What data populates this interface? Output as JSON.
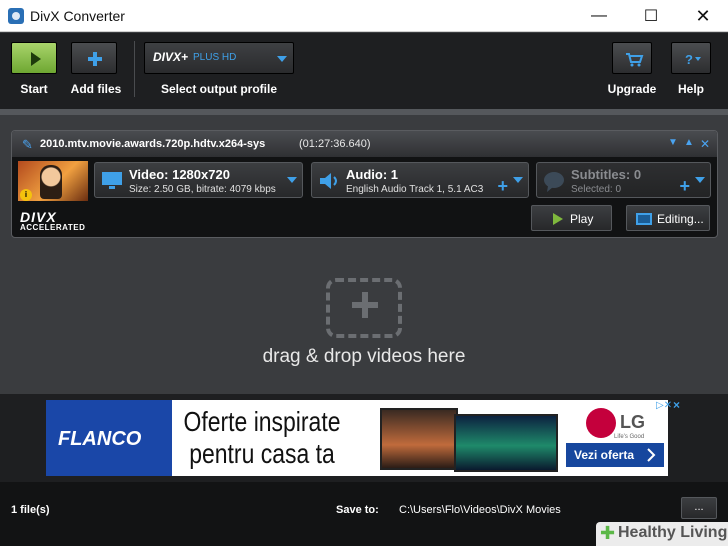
{
  "window": {
    "title": "DivX Converter",
    "minimize": "—",
    "maximize": "☐",
    "close": "✕"
  },
  "toolbar": {
    "start_label": "Start",
    "add_files_label": "Add files",
    "profile_label": "Select output profile",
    "profile_value_brand": "DIVX+",
    "profile_value_name": "PLUS HD",
    "upgrade_label": "Upgrade",
    "help_label": "Help"
  },
  "job": {
    "filename": "2010.mtv.movie.awards.720p.hdtv.x264-sys",
    "duration": "(01:27:36.640)",
    "logo": "DIVX",
    "logo_sub": "ACCELERATED",
    "video": {
      "title": "Video: 1280x720",
      "detail": "Size: 2.50 GB, bitrate: 4079 kbps"
    },
    "audio": {
      "title": "Audio: 1",
      "detail": "English Audio Track 1, 5.1 AC3"
    },
    "subtitles": {
      "title": "Subtitles: 0",
      "detail": "Selected: 0"
    },
    "play_label": "Play",
    "editing_label": "Editing..."
  },
  "drop": {
    "text": "drag & drop videos here"
  },
  "ad": {
    "brand": "FLANCO",
    "headline_line1": "Oferte inspirate",
    "headline_line2": "pentru casa ta",
    "lg_logo": "LG",
    "lg_tagline": "Life's Good",
    "cta": "Vezi oferta",
    "close": "×"
  },
  "status": {
    "files": "1 file(s)",
    "save_to_label": "Save to:",
    "save_path": "C:\\Users\\Flo\\Videos\\DivX Movies",
    "browse": "..."
  },
  "watermark": {
    "text": "Healthy Living"
  },
  "colors": {
    "accent": "#3fa0e8",
    "start_green": "#7fb83d",
    "background": "#3a3c3f"
  }
}
